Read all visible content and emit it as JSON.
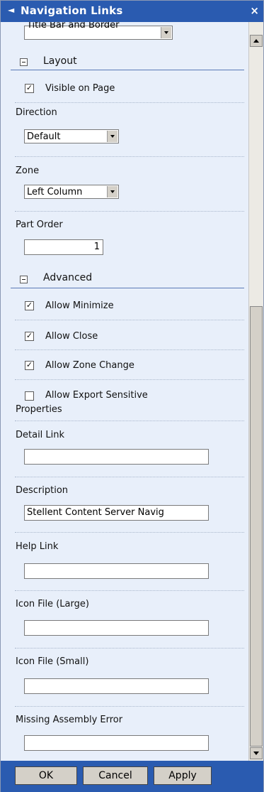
{
  "panel": {
    "title": "Navigation Links",
    "collapse_icon": "triangle-left-icon",
    "close_label": "×"
  },
  "top_partial": {
    "dropdown_value": "Title Bar and Border"
  },
  "layout": {
    "header": "Layout",
    "visible_on_page": {
      "label": "Visible on Page",
      "checked": true
    },
    "direction": {
      "label": "Direction",
      "value": "Default"
    },
    "zone": {
      "label": "Zone",
      "value": "Left Column"
    },
    "part_order": {
      "label": "Part Order",
      "value": "1"
    }
  },
  "advanced": {
    "header": "Advanced",
    "allow_minimize": {
      "label": "Allow Minimize",
      "checked": true
    },
    "allow_close": {
      "label": "Allow Close",
      "checked": true
    },
    "allow_zone_change": {
      "label": "Allow Zone Change",
      "checked": true
    },
    "allow_export": {
      "label_line1": "Allow Export Sensitive",
      "label_line2": "Properties",
      "checked": false
    },
    "detail_link": {
      "label": "Detail Link",
      "value": ""
    },
    "description": {
      "label": "Description",
      "value": "Stellent Content Server Navig"
    },
    "help_link": {
      "label": "Help Link",
      "value": ""
    },
    "icon_large": {
      "label": "Icon File (Large)",
      "value": ""
    },
    "icon_small": {
      "label": "Icon File (Small)",
      "value": ""
    },
    "missing_assembly": {
      "label": "Missing Assembly Error",
      "value": ""
    }
  },
  "footer": {
    "ok": "OK",
    "cancel": "Cancel",
    "apply": "Apply"
  },
  "colors": {
    "titlebar": "#2a5bb0",
    "panel_bg": "#e8effa",
    "button_face": "#d4d0c8"
  }
}
